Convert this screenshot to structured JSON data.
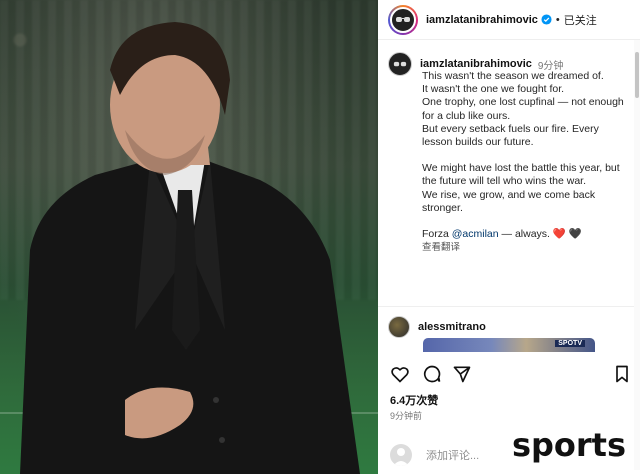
{
  "header": {
    "username": "iamzlatanibrahimovic",
    "separator": "•",
    "follow_status": "已关注"
  },
  "post": {
    "username": "iamzlatanibrahimovic",
    "time": "9分钟",
    "lines": [
      "This wasn't the season we dreamed of.",
      "It wasn't the one we fought for.",
      "One trophy, one lost cupfinal — not enough for a club like ours.",
      "But every setback fuels our fire. Every lesson builds our future.",
      "We might have lost the battle this year, but the future will tell who wins the war.",
      "We rise, we grow, and we come back stronger."
    ],
    "closing_prefix": "Forza ",
    "mention": "@acmilan",
    "closing_suffix": " — always. ",
    "emoji_red_heart": "❤️",
    "emoji_black_heart": "🖤",
    "translate": "查看翻译"
  },
  "comment": {
    "username": "alessmitrano",
    "image_tag": "SPOTV"
  },
  "stats": {
    "likes": "6.4万次赞",
    "ago": "9分钟前"
  },
  "add_comment": {
    "placeholder": "添加评论..."
  },
  "watermark": {
    "text": "sports"
  },
  "colors": {
    "mention": "#00376b",
    "verified": "#0095f6",
    "heart": "#e0245e"
  }
}
